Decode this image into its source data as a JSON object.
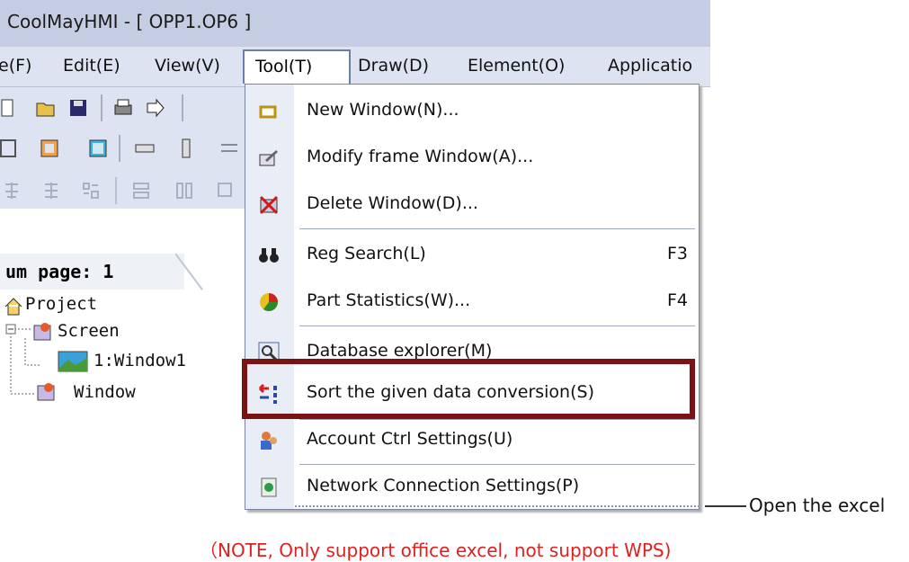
{
  "window": {
    "title": "CoolMayHMI - [ OPP1.OP6 ]"
  },
  "menubar": {
    "items": [
      {
        "label": "e(F)",
        "mnemonic": "F"
      },
      {
        "label": "Edit(E)"
      },
      {
        "label": "View(V)"
      },
      {
        "label": "Tool(T)"
      },
      {
        "label": "Draw(D)"
      },
      {
        "label": "Element(O)"
      },
      {
        "label": "Applicatio"
      }
    ]
  },
  "tree": {
    "page_label": "um page: 1",
    "nodes": [
      {
        "label": "Project",
        "icon": "house-icon"
      },
      {
        "label": "Screen",
        "icon": "screen-folder-icon"
      },
      {
        "label": "1:Window1",
        "icon": "window-thumbnail-icon"
      },
      {
        "label": "Window",
        "icon": "window-folder-icon"
      }
    ]
  },
  "tool_menu": {
    "items": [
      {
        "label": "New Window(N)...",
        "shortcut": "",
        "icon": "new-window-icon"
      },
      {
        "label": "Modify frame Window(A)...",
        "shortcut": "",
        "icon": "modify-window-icon"
      },
      {
        "label": "Delete Window(D)...",
        "shortcut": "",
        "icon": "delete-window-icon"
      },
      {
        "label": "Reg Search(L)",
        "shortcut": "F3",
        "icon": "binoculars-icon"
      },
      {
        "label": "Part Statistics(W)...",
        "shortcut": "F4",
        "icon": "statistics-icon"
      },
      {
        "label": "Database explorer(M)",
        "shortcut": "",
        "icon": "database-search-icon"
      },
      {
        "label": "Sort the given data conversion(S)",
        "shortcut": "",
        "icon": "sort-conversion-icon"
      },
      {
        "label": "Account Ctrl Settings(U)",
        "shortcut": "",
        "icon": "account-icon"
      },
      {
        "label": "Network Connection Settings(P)",
        "shortcut": "",
        "icon": "network-icon"
      }
    ]
  },
  "annotation": "Open the excel",
  "note": "（NOTE, Only support office excel, not support WPS)",
  "colors": {
    "highlight": "#7a1414",
    "note_text": "#e02020",
    "menu_bg": "#dde3f0"
  }
}
